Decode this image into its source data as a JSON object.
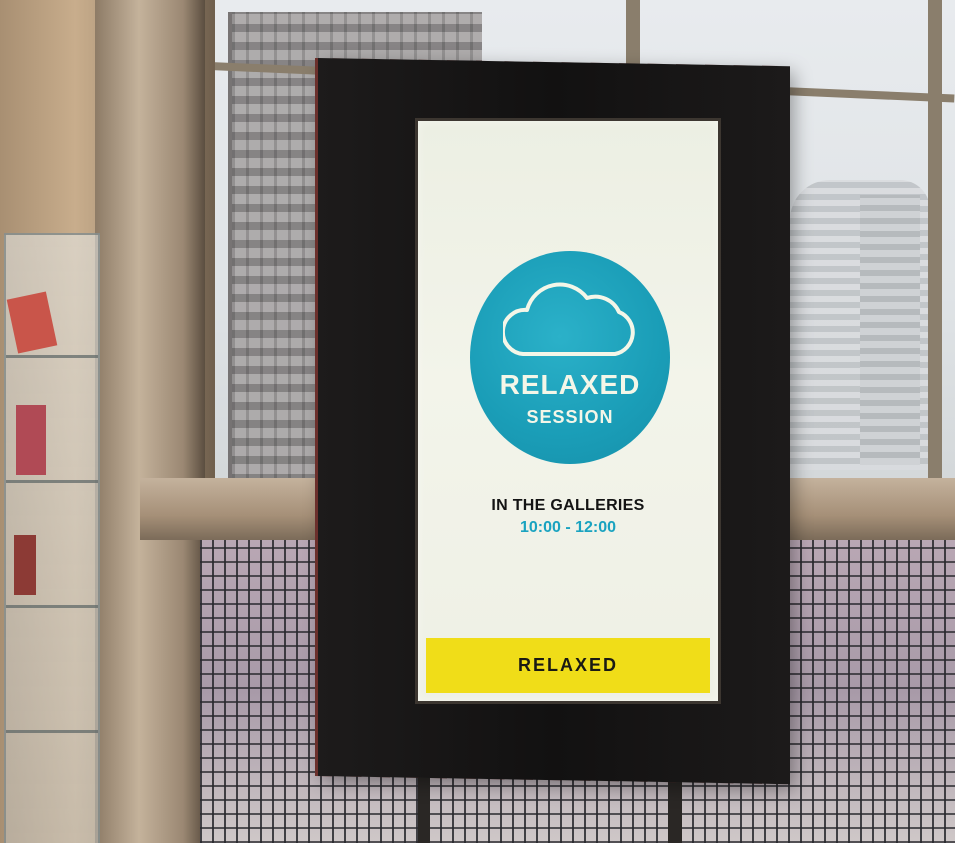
{
  "sign": {
    "icon": "cloud-icon",
    "title": "RELAXED",
    "subtitle": "SESSION",
    "location": "IN THE GALLERIES",
    "time": "10:00 - 12:00",
    "banner": "RELAXED"
  },
  "colors": {
    "circle": "#1a9db7",
    "time_text": "#1aa3c0",
    "banner": "#f0dd18",
    "frame": "#121111",
    "screen_background": "#f3f4ea"
  }
}
